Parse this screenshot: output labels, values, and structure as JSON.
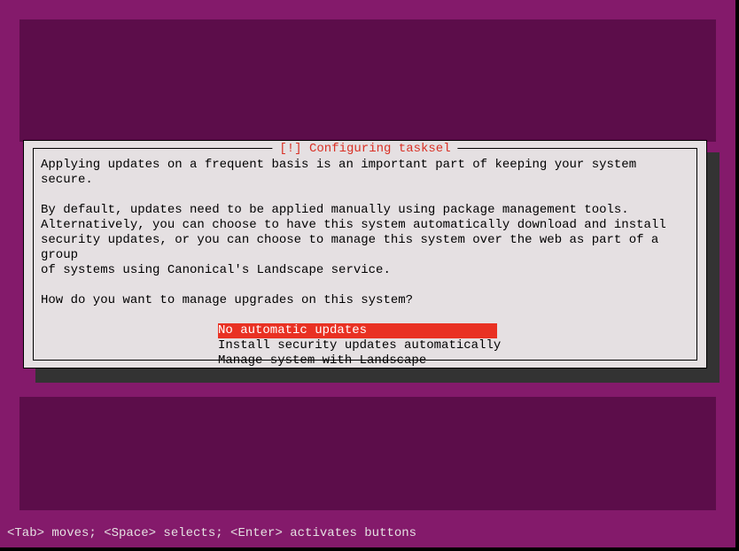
{
  "dialog": {
    "title": "[!] Configuring tasksel",
    "para1": "Applying updates on a frequent basis is an important part of keeping your system secure.",
    "para2": "By default, updates need to be applied manually using package management tools.\nAlternatively, you can choose to have this system automatically download and install\nsecurity updates, or you can choose to manage this system over the web as part of a group\nof systems using Canonical's Landscape service.",
    "prompt": "How do you want to manage upgrades on this system?",
    "options": [
      "No automatic updates",
      "Install security updates automatically",
      "Manage system with Landscape"
    ],
    "selected_index": 0
  },
  "footer": {
    "hint": "<Tab> moves; <Space> selects; <Enter> activates buttons"
  }
}
